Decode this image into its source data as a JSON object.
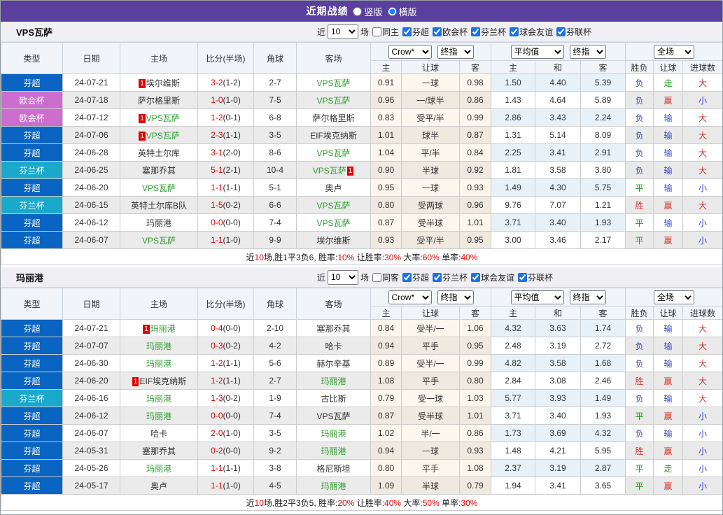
{
  "topbar": {
    "title": "近期战绩",
    "radios": [
      {
        "label": "竖版",
        "checked": false
      },
      {
        "label": "横版",
        "checked": true
      }
    ]
  },
  "colors": {
    "topbar_bg": "#5a3f9f",
    "blue": "#0a64c2",
    "purple": "#cb6ece",
    "cyan": "#1aa9cb",
    "focal_team_green": "#2e9e2e",
    "score_red": "#e60000",
    "result_red": "#d2342c",
    "result_blue": "#3a45c4",
    "result_green": "#12a012",
    "checkbox_accent": "#1a73e8"
  },
  "header": {
    "cols": [
      "类型",
      "日期",
      "主场",
      "比分(半场)",
      "角球",
      "客场"
    ],
    "odds_selects": [
      "Crow*",
      "终指"
    ],
    "avg_selects": [
      "平均值",
      "终指"
    ],
    "scope_select": "全场",
    "sub": [
      "主",
      "让球",
      "客",
      "主",
      "和",
      "客",
      "胜负",
      "让球",
      "进球数"
    ]
  },
  "tables": [
    {
      "team": "VPS瓦萨",
      "filter": {
        "recent_label": "近",
        "count": "10",
        "games_label": "场",
        "same_label": "同主",
        "same_checked": false,
        "leagues": [
          "芬超",
          "欧会杯",
          "芬兰杯",
          "球会友谊",
          "芬联杯"
        ]
      },
      "rows": [
        {
          "type": "芬超",
          "tc": "blue",
          "date": "24-07-21",
          "home": {
            "name": "埃尔维斯",
            "focal": false,
            "rc": "1"
          },
          "ft": "3-2",
          "ht": "(1-2)",
          "corner": "2-7",
          "away": {
            "name": "VPS瓦萨",
            "focal": true
          },
          "odds": [
            "0.91",
            "一球",
            "0.98"
          ],
          "avg": [
            "1.50",
            "4.40",
            "5.39"
          ],
          "res": [
            [
              "负",
              "b"
            ],
            [
              "走",
              "g"
            ],
            [
              "大",
              "r"
            ]
          ]
        },
        {
          "type": "欧会杯",
          "tc": "purple",
          "date": "24-07-18",
          "home": {
            "name": "萨尔格里斯",
            "focal": false
          },
          "ft": "1-0",
          "ht": "(1-0)",
          "corner": "7-5",
          "away": {
            "name": "VPS瓦萨",
            "focal": true
          },
          "odds": [
            "0.96",
            "一/球半",
            "0.86"
          ],
          "avg": [
            "1.43",
            "4.64",
            "5.89"
          ],
          "res": [
            [
              "负",
              "b"
            ],
            [
              "赢",
              "r"
            ],
            [
              "小",
              "b"
            ]
          ]
        },
        {
          "type": "欧会杯",
          "tc": "purple",
          "date": "24-07-12",
          "home": {
            "name": "VPS瓦萨",
            "focal": true,
            "rc": "1"
          },
          "ft": "1-2",
          "ht": "(0-1)",
          "corner": "6-8",
          "away": {
            "name": "萨尔格里斯",
            "focal": false
          },
          "odds": [
            "0.83",
            "受平/半",
            "0.99"
          ],
          "avg": [
            "2.86",
            "3.43",
            "2.24"
          ],
          "res": [
            [
              "负",
              "b"
            ],
            [
              "输",
              "b"
            ],
            [
              "大",
              "r"
            ]
          ]
        },
        {
          "type": "芬超",
          "tc": "blue",
          "date": "24-07-06",
          "home": {
            "name": "VPS瓦萨",
            "focal": true,
            "rc": "1"
          },
          "ft": "2-3",
          "ht": "(1-1)",
          "corner": "3-5",
          "away": {
            "name": "EIF埃克纳斯",
            "focal": false
          },
          "odds": [
            "1.01",
            "球半",
            "0.87"
          ],
          "avg": [
            "1.31",
            "5.14",
            "8.09"
          ],
          "res": [
            [
              "负",
              "b"
            ],
            [
              "输",
              "b"
            ],
            [
              "大",
              "r"
            ]
          ]
        },
        {
          "type": "芬超",
          "tc": "blue",
          "date": "24-06-28",
          "home": {
            "name": "英特土尔库",
            "focal": false
          },
          "ft": "3-1",
          "ht": "(2-0)",
          "corner": "8-6",
          "away": {
            "name": "VPS瓦萨",
            "focal": true
          },
          "odds": [
            "1.04",
            "平/半",
            "0.84"
          ],
          "avg": [
            "2.25",
            "3.41",
            "2.91"
          ],
          "res": [
            [
              "负",
              "b"
            ],
            [
              "输",
              "b"
            ],
            [
              "大",
              "r"
            ]
          ]
        },
        {
          "type": "芬兰杯",
          "tc": "cyan",
          "date": "24-06-25",
          "home": {
            "name": "塞那乔其",
            "focal": false
          },
          "ft": "5-1",
          "ht": "(2-1)",
          "corner": "10-4",
          "away": {
            "name": "VPS瓦萨",
            "focal": true,
            "rc": "1"
          },
          "odds": [
            "0.90",
            "半球",
            "0.92"
          ],
          "avg": [
            "1.81",
            "3.58",
            "3.80"
          ],
          "res": [
            [
              "负",
              "b"
            ],
            [
              "输",
              "b"
            ],
            [
              "大",
              "r"
            ]
          ]
        },
        {
          "type": "芬超",
          "tc": "blue",
          "date": "24-06-20",
          "home": {
            "name": "VPS瓦萨",
            "focal": true
          },
          "ft": "1-1",
          "ht": "(1-1)",
          "corner": "5-1",
          "away": {
            "name": "奥卢",
            "focal": false
          },
          "odds": [
            "0.95",
            "一球",
            "0.93"
          ],
          "avg": [
            "1.49",
            "4.30",
            "5.75"
          ],
          "res": [
            [
              "平",
              "g"
            ],
            [
              "输",
              "b"
            ],
            [
              "小",
              "b"
            ]
          ]
        },
        {
          "type": "芬兰杯",
          "tc": "cyan",
          "date": "24-06-15",
          "home": {
            "name": "英特土尔库B队",
            "focal": false
          },
          "ft": "1-5",
          "ht": "(0-2)",
          "corner": "6-6",
          "away": {
            "name": "VPS瓦萨",
            "focal": true
          },
          "odds": [
            "0.80",
            "受两球",
            "0.96"
          ],
          "avg": [
            "9.76",
            "7.07",
            "1.21"
          ],
          "res": [
            [
              "胜",
              "r"
            ],
            [
              "赢",
              "r"
            ],
            [
              "大",
              "r"
            ]
          ]
        },
        {
          "type": "芬超",
          "tc": "blue",
          "date": "24-06-12",
          "home": {
            "name": "玛丽港",
            "focal": false
          },
          "ft": "0-0",
          "ht": "(0-0)",
          "corner": "7-4",
          "away": {
            "name": "VPS瓦萨",
            "focal": true
          },
          "odds": [
            "0.87",
            "受半球",
            "1.01"
          ],
          "avg": [
            "3.71",
            "3.40",
            "1.93"
          ],
          "res": [
            [
              "平",
              "g"
            ],
            [
              "输",
              "b"
            ],
            [
              "小",
              "b"
            ]
          ]
        },
        {
          "type": "芬超",
          "tc": "blue",
          "date": "24-06-07",
          "home": {
            "name": "VPS瓦萨",
            "focal": true
          },
          "ft": "1-1",
          "ht": "(1-0)",
          "corner": "9-9",
          "away": {
            "name": "埃尔维斯",
            "focal": false
          },
          "odds": [
            "0.93",
            "受平/半",
            "0.95"
          ],
          "avg": [
            "3.00",
            "3.46",
            "2.17"
          ],
          "res": [
            [
              "平",
              "g"
            ],
            [
              "赢",
              "r"
            ],
            [
              "小",
              "b"
            ]
          ]
        }
      ],
      "summary": [
        [
          "近",
          0
        ],
        [
          "10",
          1
        ],
        [
          "场,胜1平3负6, 胜率:",
          0
        ],
        [
          "10%",
          1
        ],
        [
          " 让胜率:",
          0
        ],
        [
          "30%",
          1
        ],
        [
          " 大率:",
          0
        ],
        [
          "60%",
          1
        ],
        [
          " 单率:",
          0
        ],
        [
          "40%",
          1
        ]
      ]
    },
    {
      "team": "玛丽港",
      "filter": {
        "recent_label": "近",
        "count": "10",
        "games_label": "场",
        "same_label": "同客",
        "same_checked": false,
        "leagues": [
          "芬超",
          "芬兰杯",
          "球会友谊",
          "芬联杯"
        ]
      },
      "rows": [
        {
          "type": "芬超",
          "tc": "blue",
          "date": "24-07-21",
          "home": {
            "name": "玛丽港",
            "focal": true,
            "rc": "1"
          },
          "ft": "0-4",
          "ht": "(0-0)",
          "corner": "2-10",
          "away": {
            "name": "塞那乔其",
            "focal": false
          },
          "odds": [
            "0.84",
            "受半/一",
            "1.06"
          ],
          "avg": [
            "4.32",
            "3.63",
            "1.74"
          ],
          "res": [
            [
              "负",
              "b"
            ],
            [
              "输",
              "b"
            ],
            [
              "大",
              "r"
            ]
          ]
        },
        {
          "type": "芬超",
          "tc": "blue",
          "date": "24-07-07",
          "home": {
            "name": "玛丽港",
            "focal": true
          },
          "ft": "0-3",
          "ht": "(0-2)",
          "corner": "4-2",
          "away": {
            "name": "哈卡",
            "focal": false
          },
          "odds": [
            "0.94",
            "平手",
            "0.95"
          ],
          "avg": [
            "2.48",
            "3.19",
            "2.72"
          ],
          "res": [
            [
              "负",
              "b"
            ],
            [
              "输",
              "b"
            ],
            [
              "大",
              "r"
            ]
          ]
        },
        {
          "type": "芬超",
          "tc": "blue",
          "date": "24-06-30",
          "home": {
            "name": "玛丽港",
            "focal": true
          },
          "ft": "1-2",
          "ht": "(1-1)",
          "corner": "5-6",
          "away": {
            "name": "赫尔辛基",
            "focal": false
          },
          "odds": [
            "0.89",
            "受半/一",
            "0.99"
          ],
          "avg": [
            "4.82",
            "3.58",
            "1.68"
          ],
          "res": [
            [
              "负",
              "b"
            ],
            [
              "输",
              "b"
            ],
            [
              "大",
              "r"
            ]
          ]
        },
        {
          "type": "芬超",
          "tc": "blue",
          "date": "24-06-20",
          "home": {
            "name": "EIF埃克纳斯",
            "focal": false,
            "rc": "1"
          },
          "ft": "1-2",
          "ht": "(1-1)",
          "corner": "2-7",
          "away": {
            "name": "玛丽港",
            "focal": true
          },
          "odds": [
            "1.08",
            "平手",
            "0.80"
          ],
          "avg": [
            "2.84",
            "3.08",
            "2.46"
          ],
          "res": [
            [
              "胜",
              "r"
            ],
            [
              "赢",
              "r"
            ],
            [
              "大",
              "r"
            ]
          ]
        },
        {
          "type": "芬兰杯",
          "tc": "cyan",
          "date": "24-06-16",
          "home": {
            "name": "玛丽港",
            "focal": true
          },
          "ft": "1-3",
          "ht": "(0-2)",
          "corner": "1-9",
          "away": {
            "name": "古比斯",
            "focal": false
          },
          "odds": [
            "0.79",
            "受一球",
            "1.03"
          ],
          "avg": [
            "5.77",
            "3.93",
            "1.49"
          ],
          "res": [
            [
              "负",
              "b"
            ],
            [
              "输",
              "b"
            ],
            [
              "大",
              "r"
            ]
          ]
        },
        {
          "type": "芬超",
          "tc": "blue",
          "date": "24-06-12",
          "home": {
            "name": "玛丽港",
            "focal": true
          },
          "ft": "0-0",
          "ht": "(0-0)",
          "corner": "7-4",
          "away": {
            "name": "VPS瓦萨",
            "focal": false
          },
          "odds": [
            "0.87",
            "受半球",
            "1.01"
          ],
          "avg": [
            "3.71",
            "3.40",
            "1.93"
          ],
          "res": [
            [
              "平",
              "g"
            ],
            [
              "赢",
              "r"
            ],
            [
              "小",
              "b"
            ]
          ]
        },
        {
          "type": "芬超",
          "tc": "blue",
          "date": "24-06-07",
          "home": {
            "name": "哈卡",
            "focal": false
          },
          "ft": "2-0",
          "ht": "(1-0)",
          "corner": "3-5",
          "away": {
            "name": "玛丽港",
            "focal": true
          },
          "odds": [
            "1.02",
            "半/一",
            "0.86"
          ],
          "avg": [
            "1.73",
            "3.69",
            "4.32"
          ],
          "res": [
            [
              "负",
              "b"
            ],
            [
              "输",
              "b"
            ],
            [
              "小",
              "b"
            ]
          ]
        },
        {
          "type": "芬超",
          "tc": "blue",
          "date": "24-05-31",
          "home": {
            "name": "塞那乔其",
            "focal": false
          },
          "ft": "0-2",
          "ht": "(0-0)",
          "corner": "9-2",
          "away": {
            "name": "玛丽港",
            "focal": true
          },
          "odds": [
            "0.94",
            "一球",
            "0.93"
          ],
          "avg": [
            "1.48",
            "4.21",
            "5.95"
          ],
          "res": [
            [
              "胜",
              "r"
            ],
            [
              "赢",
              "r"
            ],
            [
              "小",
              "b"
            ]
          ]
        },
        {
          "type": "芬超",
          "tc": "blue",
          "date": "24-05-26",
          "home": {
            "name": "玛丽港",
            "focal": true
          },
          "ft": "1-1",
          "ht": "(1-1)",
          "corner": "3-8",
          "away": {
            "name": "格尼斯坦",
            "focal": false
          },
          "odds": [
            "0.80",
            "平手",
            "1.08"
          ],
          "avg": [
            "2.37",
            "3.19",
            "2.87"
          ],
          "res": [
            [
              "平",
              "g"
            ],
            [
              "走",
              "g"
            ],
            [
              "小",
              "b"
            ]
          ]
        },
        {
          "type": "芬超",
          "tc": "blue",
          "date": "24-05-17",
          "home": {
            "name": "奥卢",
            "focal": false
          },
          "ft": "1-1",
          "ht": "(1-0)",
          "corner": "4-5",
          "away": {
            "name": "玛丽港",
            "focal": true
          },
          "odds": [
            "1.09",
            "半球",
            "0.79"
          ],
          "avg": [
            "1.94",
            "3.41",
            "3.65"
          ],
          "res": [
            [
              "平",
              "g"
            ],
            [
              "赢",
              "r"
            ],
            [
              "小",
              "b"
            ]
          ]
        }
      ],
      "summary": [
        [
          "近",
          0
        ],
        [
          "10",
          1
        ],
        [
          "场,胜2平3负5, 胜率:",
          0
        ],
        [
          "20%",
          1
        ],
        [
          " 让胜率:",
          0
        ],
        [
          "40%",
          1
        ],
        [
          " 大率:",
          0
        ],
        [
          "50%",
          1
        ],
        [
          " 单率:",
          0
        ],
        [
          "30%",
          1
        ]
      ]
    }
  ]
}
